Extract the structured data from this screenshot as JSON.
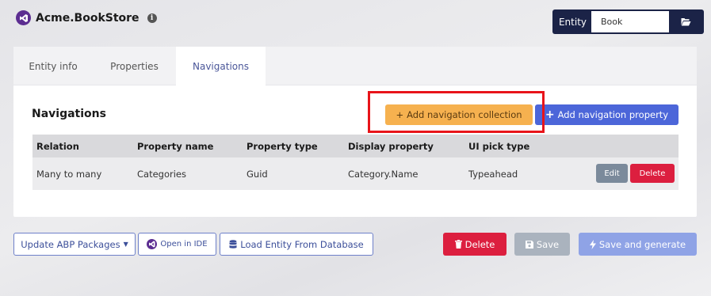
{
  "header": {
    "title": "Acme.BookStore",
    "info_icon": "info-circle-icon",
    "entity_label": "Entity",
    "entity_value": "Book",
    "folder_icon": "folder-open-icon"
  },
  "tabs": [
    {
      "label": "Entity info",
      "active": false
    },
    {
      "label": "Properties",
      "active": false
    },
    {
      "label": "Navigations",
      "active": true
    }
  ],
  "navigations": {
    "title": "Navigations",
    "add_collection_label": "Add navigation collection",
    "add_property_label": "Add navigation property",
    "columns": [
      "Relation",
      "Property name",
      "Property type",
      "Display property",
      "UI pick type"
    ],
    "rows": [
      {
        "relation": "Many to many",
        "property_name": "Categories",
        "property_type": "Guid",
        "display_property": "Category.Name",
        "ui_pick_type": "Typeahead",
        "edit_label": "Edit",
        "delete_label": "Delete"
      }
    ]
  },
  "toolbar": {
    "update_label": "Update ABP Packages",
    "open_ide_label": "Open in IDE",
    "load_entity_label": "Load Entity From Database",
    "delete_label": "Delete",
    "save_label": "Save",
    "save_generate_label": "Save and generate"
  },
  "colors": {
    "accent": "#4c66d9",
    "warning": "#f6b14f",
    "danger": "#dc1f3f",
    "highlight": "#e8141a",
    "entity_box": "#1b2347"
  }
}
